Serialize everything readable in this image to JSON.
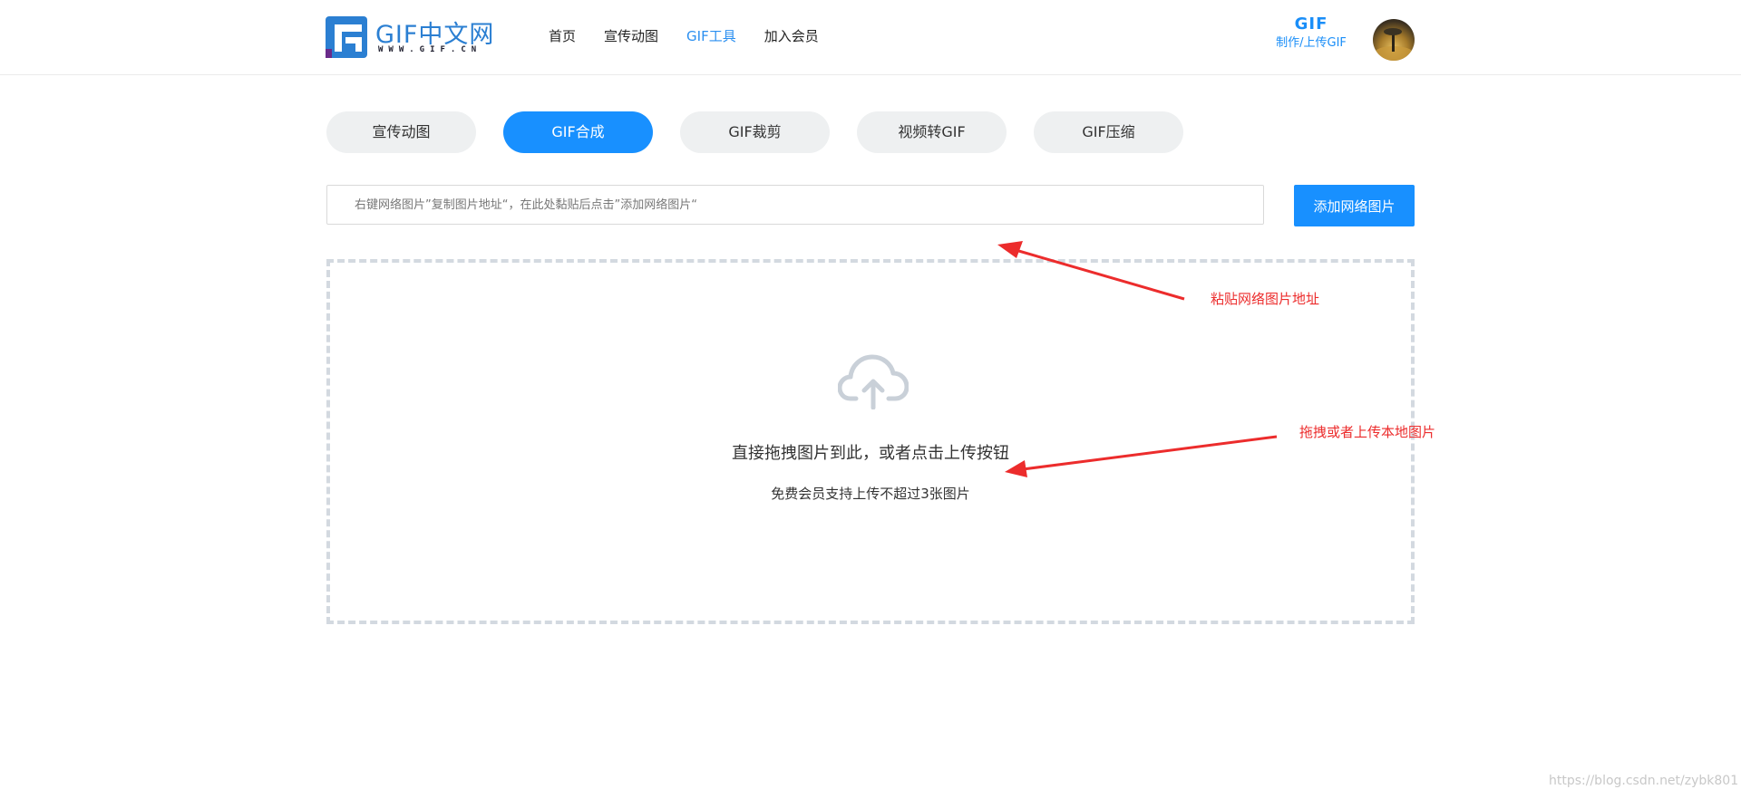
{
  "header": {
    "logo": {
      "text": "GIF中文网",
      "sub": "WWW.GIF.CN"
    },
    "nav": [
      {
        "label": "首页",
        "active": false
      },
      {
        "label": "宣传动图",
        "active": false
      },
      {
        "label": "GIF工具",
        "active": true
      },
      {
        "label": "加入会员",
        "active": false
      }
    ],
    "make_gif": {
      "title": "GIF",
      "sub": "制作/上传GIF"
    },
    "avatar_icon": "user-avatar"
  },
  "tabs": [
    {
      "label": "宣传动图",
      "active": false
    },
    {
      "label": "GIF合成",
      "active": true
    },
    {
      "label": "GIF裁剪",
      "active": false
    },
    {
      "label": "视频转GIF",
      "active": false
    },
    {
      "label": "GIF压缩",
      "active": false
    }
  ],
  "url_input": {
    "placeholder": "右键网络图片”复制图片地址“，在此处黏贴后点击”添加网络图片“",
    "value": ""
  },
  "add_url_button": "添加网络图片",
  "dropzone": {
    "icon": "cloud-upload-icon",
    "title": "直接拖拽图片到此，或者点击上传按钮",
    "subtitle": "免费会员支持上传不超过3张图片"
  },
  "annotations": {
    "paste_url": "粘贴网络图片地址",
    "drag_upload": "拖拽或者上传本地图片"
  },
  "watermark": "https://blog.csdn.net/zybk801",
  "colors": {
    "accent": "#1890ff",
    "annotation": "#ec2c2c",
    "tab_bg": "#eef0f1",
    "dash_border": "#d3d9e0"
  }
}
